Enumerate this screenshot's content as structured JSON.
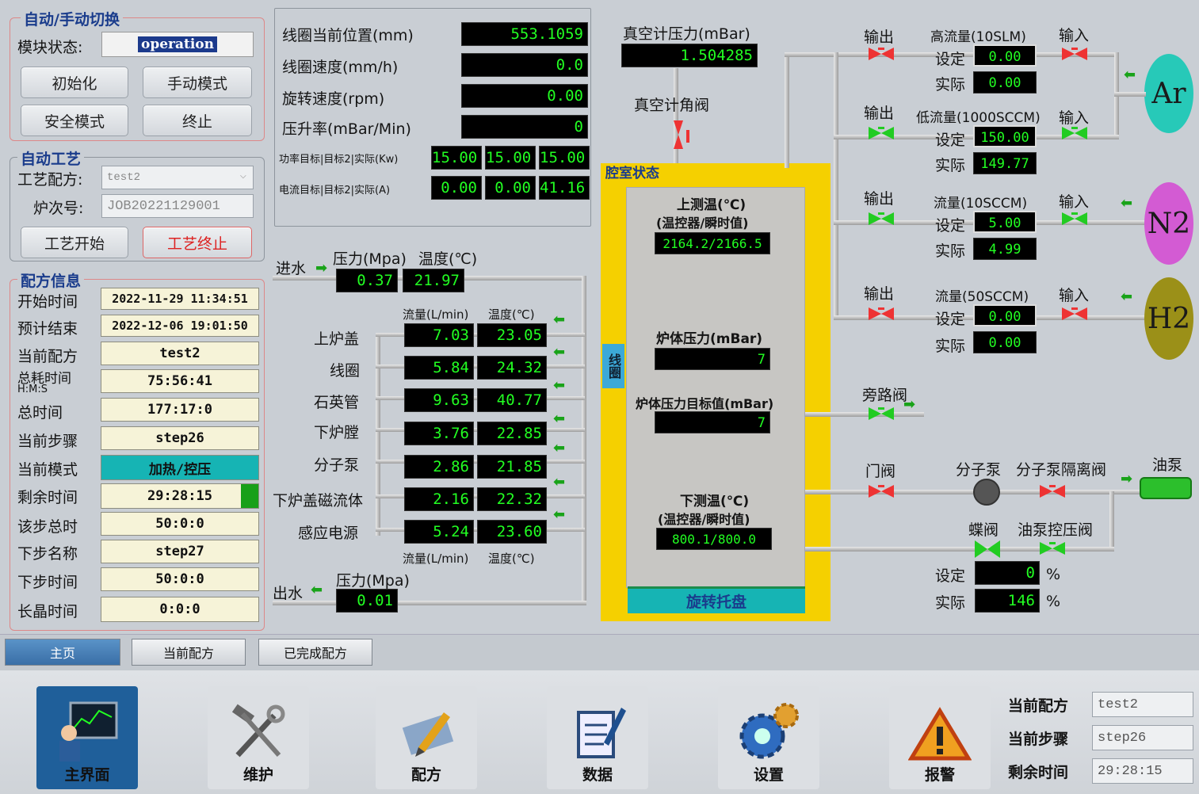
{
  "mode": {
    "title": "自动/手动切换",
    "status_label": "模块状态:",
    "status_value": "operation",
    "init": "初始化",
    "manual": "手动模式",
    "safe": "安全模式",
    "stop": "终止"
  },
  "process": {
    "title": "自动工艺",
    "recipe_label": "工艺配方:",
    "recipe_value": "test2",
    "batch_label": "炉次号:",
    "batch_value": "JOB20221129001",
    "start": "工艺开始",
    "end": "工艺终止"
  },
  "recipe_info": {
    "title": "配方信息",
    "rows": [
      {
        "label": "开始时间",
        "value": "2022-11-29 11:34:51"
      },
      {
        "label": "预计结束",
        "value": "2022-12-06 19:01:50"
      },
      {
        "label": "当前配方",
        "value": "test2"
      },
      {
        "label": "总耗时间",
        "sub": "H:M:S",
        "value": "75:56:41"
      },
      {
        "label": "总时间",
        "value": "177:17:0"
      },
      {
        "label": "当前步骤",
        "value": "step26"
      },
      {
        "label": "当前模式",
        "value": "加热/控压"
      },
      {
        "label": "剩余时间",
        "value": "29:28:15"
      },
      {
        "label": "该步总时",
        "value": "50:0:0"
      },
      {
        "label": "下步名称",
        "value": "step27"
      },
      {
        "label": "下步时间",
        "value": "50:0:0"
      },
      {
        "label": "长晶时间",
        "value": "0:0:0"
      }
    ]
  },
  "coil": {
    "pos_label": "线圈当前位置(mm)",
    "pos": "553.1059",
    "speed_label": "线圈速度(mm/h)",
    "speed": "0.0",
    "rot_label": "旋转速度(rpm)",
    "rot": "0.00",
    "rise_label": "压升率(mBar/Min)",
    "rise": "0",
    "power_label": "功率目标|目标2|实际(Kw)",
    "power": [
      "15.00",
      "15.00",
      "15.00"
    ],
    "current_label": "电流目标|目标2|实际(A)",
    "current": [
      "0.00",
      "0.00",
      "41.16"
    ]
  },
  "water": {
    "in_label": "进水",
    "pressure_label": "压力(Mpa)",
    "temp_label": "温度(℃)",
    "in_pressure": "0.37",
    "in_temp": "21.97",
    "flow_label": "流量(L/min)",
    "temp2_label": "温度(℃)",
    "rows": [
      {
        "name": "上炉盖",
        "flow": "7.03",
        "temp": "23.05"
      },
      {
        "name": "线圈",
        "flow": "5.84",
        "temp": "24.32"
      },
      {
        "name": "石英管",
        "flow": "9.63",
        "temp": "40.77"
      },
      {
        "name": "下炉膛",
        "flow": "3.76",
        "temp": "22.85"
      },
      {
        "name": "分子泵",
        "flow": "2.86",
        "temp": "21.85"
      },
      {
        "name": "下炉盖磁流体",
        "flow": "2.16",
        "temp": "22.32"
      },
      {
        "name": "感应电源",
        "flow": "5.24",
        "temp": "23.60"
      }
    ],
    "out_label": "出水",
    "out_pressure_label": "压力(Mpa)",
    "out_pressure": "0.01"
  },
  "chamber": {
    "vac_label": "真空计压力(mBar)",
    "vac": "1.504285",
    "vac_valve": "真空计角阀",
    "status_label": "腔室状态",
    "coil_tag": "线圈",
    "top_temp_label": "上测温(℃)",
    "top_temp_sub": "(温控器/瞬时值)",
    "top_temp": "2164.2/2166.5",
    "press_label": "炉体压力(mBar)",
    "press": "7",
    "press_target_label": "炉体压力目标值(mBar)",
    "press_target": "7",
    "bot_temp_label": "下测温(℃)",
    "bot_temp_sub": "(温控器/瞬时值)",
    "bot_temp": "800.1/800.0",
    "tray": "旋转托盘"
  },
  "gas": {
    "out": "输出",
    "in": "输入",
    "set": "设定",
    "actual": "实际",
    "lines": [
      {
        "name": "高流量(10SLM)",
        "set": "0.00",
        "actual": "0.00",
        "gas": "Ar",
        "color": "#27c9b8"
      },
      {
        "name": "低流量(1000SCCM)",
        "set": "150.00",
        "actual": "149.77",
        "gas": "",
        "color": ""
      },
      {
        "name": "流量(10SCCM)",
        "set": "5.00",
        "actual": "4.99",
        "gas": "N2",
        "color": "#d35bd3"
      },
      {
        "name": "流量(50SCCM)",
        "set": "0.00",
        "actual": "0.00",
        "gas": "H2",
        "color": "#9b9018"
      }
    ]
  },
  "vacuum": {
    "bypass": "旁路阀",
    "gate": "门阀",
    "molpump": "分子泵",
    "mol_iso": "分子泵隔离阀",
    "oilpump": "油泵",
    "butterfly": "蝶阀",
    "oil_ctrl": "油泵控压阀",
    "set_label": "设定",
    "set": "0",
    "actual_label": "实际",
    "actual": "146",
    "unit": "%"
  },
  "tabs": [
    "主页",
    "当前配方",
    "已完成配方"
  ],
  "nav": [
    {
      "label": "主界面",
      "icon": "main-screen-icon"
    },
    {
      "label": "维护",
      "icon": "tools-icon"
    },
    {
      "label": "配方",
      "icon": "pen-icon"
    },
    {
      "label": "数据",
      "icon": "notebook-icon"
    },
    {
      "label": "设置",
      "icon": "gears-icon"
    },
    {
      "label": "报警",
      "icon": "warning-icon"
    }
  ],
  "footer": {
    "recipe_label": "当前配方",
    "recipe": "test2",
    "step_label": "当前步骤",
    "step": "step26",
    "remain_label": "剩余时间",
    "remain": "29:28:15"
  },
  "colors": {
    "digit": "#22ff22",
    "accent_blue": "#1a3c8c",
    "chamber_yellow": "#f5d000",
    "mode_teal": "#16b4b4"
  }
}
